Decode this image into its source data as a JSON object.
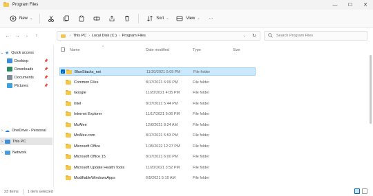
{
  "window": {
    "title": "Program Files",
    "controls": {
      "minimize": "—",
      "maximize": "☐",
      "close": "✕"
    }
  },
  "toolbar": {
    "new_label": "New",
    "sort_label": "Sort",
    "view_label": "View",
    "more_label": "···"
  },
  "address": {
    "crumbs": [
      "This PC",
      "Local Disk (C:)",
      "Program Files"
    ],
    "search_placeholder": "Search Program Files"
  },
  "sidebar": {
    "quick_access": "Quick access",
    "items": [
      {
        "label": "Desktop",
        "icon": "desktop-icon",
        "color": "#3c8fd8"
      },
      {
        "label": "Downloads",
        "icon": "downloads-icon",
        "color": "#2a8a5e"
      },
      {
        "label": "Documents",
        "icon": "documents-icon",
        "color": "#7a8a9a"
      },
      {
        "label": "Pictures",
        "icon": "pictures-icon",
        "color": "#3aa0e0"
      }
    ],
    "onedrive": "OneDrive - Personal",
    "this_pc": "This PC",
    "network": "Network"
  },
  "columns": {
    "name": "Name",
    "date": "Date modified",
    "type": "Type",
    "size": "Size"
  },
  "files": [
    {
      "name": "BlueStacks_nxt",
      "date": "11/20/2021 5:09 PM",
      "type": "File folder",
      "selected": true
    },
    {
      "name": "Common Files",
      "date": "8/17/2021 6:09 PM",
      "type": "File folder"
    },
    {
      "name": "Google",
      "date": "11/20/2021 4:05 PM",
      "type": "File folder"
    },
    {
      "name": "Intel",
      "date": "8/17/2021 5:44 PM",
      "type": "File folder"
    },
    {
      "name": "Internet Explorer",
      "date": "11/17/2021 9:06 PM",
      "type": "File folder"
    },
    {
      "name": "McAfee",
      "date": "12/6/2021 8:24 AM",
      "type": "File folder"
    },
    {
      "name": "McAfee.com",
      "date": "8/17/2021 5:53 PM",
      "type": "File folder"
    },
    {
      "name": "Microsoft Office",
      "date": "1/15/2022 12:27 PM",
      "type": "File folder"
    },
    {
      "name": "Microsoft Office 15",
      "date": "8/17/2021 6:00 PM",
      "type": "File folder"
    },
    {
      "name": "Microsoft Update Health Tools",
      "date": "11/20/2021 3:52 PM",
      "type": "File folder"
    },
    {
      "name": "ModifiableWindowsApps",
      "date": "6/5/2021 5:10 AM",
      "type": "File folder"
    }
  ],
  "status": {
    "items_count": "23 items",
    "selected_count": "1 item selected"
  },
  "colors": {
    "selection_bg": "#cce8ff",
    "selection_border": "#99d1ff",
    "folder": "#f5c84c",
    "accent": "#0067c0"
  }
}
